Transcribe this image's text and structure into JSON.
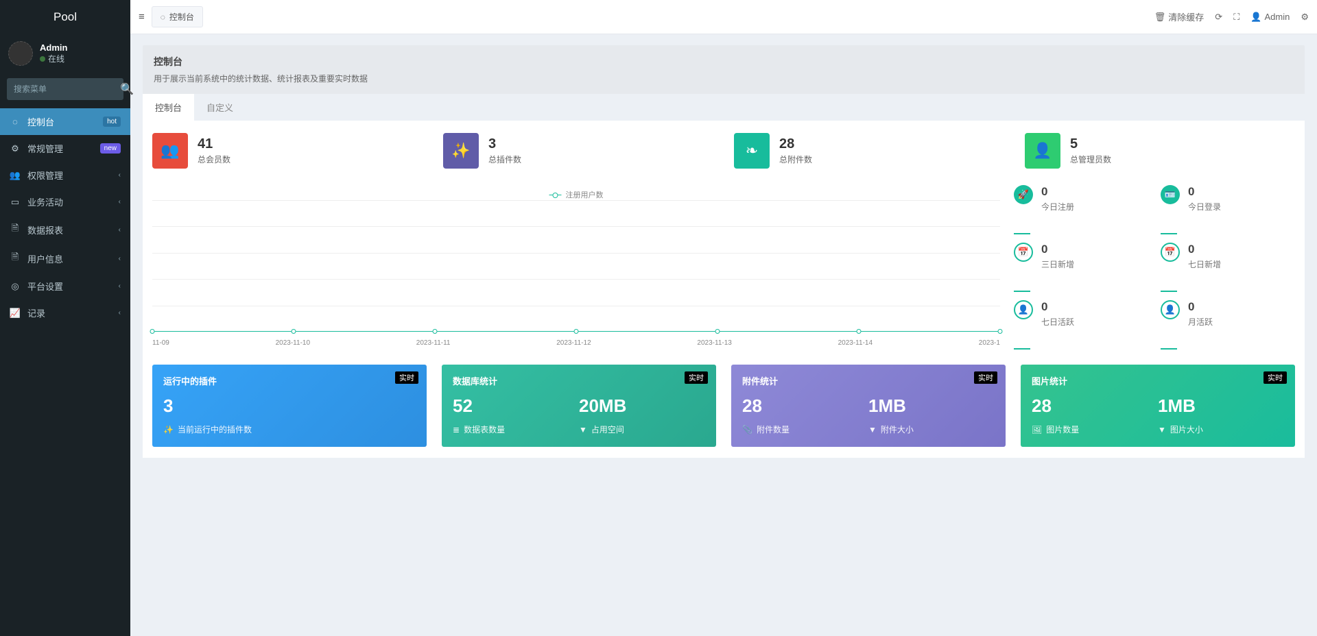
{
  "brand": "Pool",
  "user": {
    "name": "Admin",
    "status": "在线"
  },
  "search": {
    "placeholder": "搜索菜单"
  },
  "sidebar": {
    "items": [
      {
        "label": "控制台",
        "badge": "hot"
      },
      {
        "label": "常规管理",
        "badge": "new"
      },
      {
        "label": "权限管理"
      },
      {
        "label": "业务活动"
      },
      {
        "label": "数据报表"
      },
      {
        "label": "用户信息"
      },
      {
        "label": "平台设置"
      },
      {
        "label": "记录"
      }
    ]
  },
  "topbar": {
    "tab_label": "控制台",
    "clear_cache": "清除缓存",
    "admin": "Admin"
  },
  "header": {
    "title": "控制台",
    "subtitle": "用于展示当前系统中的统计数据、统计报表及重要实时数据"
  },
  "tabs": [
    {
      "label": "控制台"
    },
    {
      "label": "自定义"
    }
  ],
  "stats": [
    {
      "value": "41",
      "label": "总会员数"
    },
    {
      "value": "3",
      "label": "总插件数"
    },
    {
      "value": "28",
      "label": "总附件数"
    },
    {
      "value": "5",
      "label": "总管理员数"
    }
  ],
  "minis": [
    {
      "value": "0",
      "label": "今日注册"
    },
    {
      "value": "0",
      "label": "今日登录"
    },
    {
      "value": "0",
      "label": "三日新增"
    },
    {
      "value": "0",
      "label": "七日新增"
    },
    {
      "value": "0",
      "label": "七日活跃"
    },
    {
      "value": "0",
      "label": "月活跃"
    }
  ],
  "bcards": [
    {
      "title": "运行中的插件",
      "tag": "实时",
      "v1": "3",
      "l1": "当前运行中的插件数"
    },
    {
      "title": "数据库统计",
      "tag": "实时",
      "v1": "52",
      "l1": "数据表数量",
      "v2": "20MB",
      "l2": "占用空间"
    },
    {
      "title": "附件统计",
      "tag": "实时",
      "v1": "28",
      "l1": "附件数量",
      "v2": "1MB",
      "l2": "附件大小"
    },
    {
      "title": "图片统计",
      "tag": "实时",
      "v1": "28",
      "l1": "图片数量",
      "v2": "1MB",
      "l2": "图片大小"
    }
  ],
  "chart_data": {
    "type": "line",
    "title": "",
    "legend": "注册用户数",
    "xlabel": "",
    "ylabel": "",
    "x": [
      "11-09",
      "2023-11-10",
      "2023-11-11",
      "2023-11-12",
      "2023-11-13",
      "2023-11-14",
      "2023-1"
    ],
    "series": [
      {
        "name": "注册用户数",
        "values": [
          0,
          0,
          0,
          0,
          0,
          0,
          0
        ]
      }
    ],
    "ylim": [
      0,
      5
    ]
  }
}
